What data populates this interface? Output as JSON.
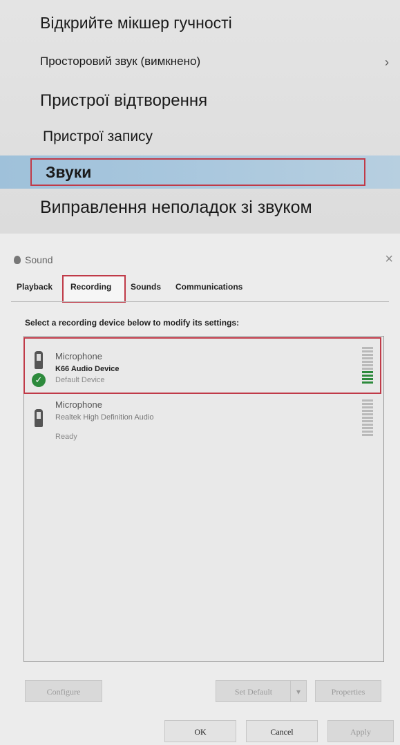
{
  "context_menu": {
    "items": [
      {
        "label": "Відкрийте мікшер гучності"
      },
      {
        "label": "Просторовий звук (вимкнено)",
        "chevron": "›"
      },
      {
        "label": "Пристрої відтворення"
      },
      {
        "label": "Пристрої запису"
      },
      {
        "label": "Звуки"
      },
      {
        "label": "Виправлення неполадок зі звуком"
      }
    ]
  },
  "dialog": {
    "title": "Sound",
    "close": "×",
    "tabs": [
      "Playback",
      "Recording",
      "Sounds",
      "Communications"
    ],
    "instruction": "Select a recording device below to modify its settings:",
    "devices": [
      {
        "name": "Microphone",
        "driver": "K66 Audio Device",
        "status": "Default Device",
        "check": "✓"
      },
      {
        "name": "Microphone",
        "driver": "Realtek High Definition Audio",
        "status": "Ready"
      }
    ],
    "buttons": {
      "configure": "Configure",
      "set_default": "Set Default",
      "dropdown": "▾",
      "properties": "Properties",
      "ok": "OK",
      "cancel": "Cancel",
      "apply": "Apply"
    }
  },
  "colors": {
    "highlight": "#a7c6dd",
    "annotation": "#c03a48",
    "check": "#2d8a3c"
  }
}
